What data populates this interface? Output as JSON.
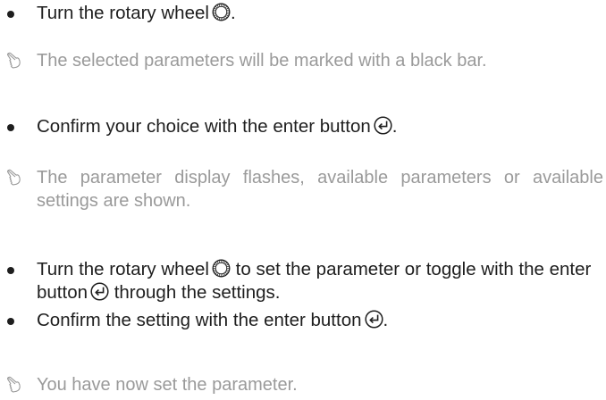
{
  "instructions": [
    {
      "kind": "step",
      "text_before": "Turn the rotary wheel",
      "icon": "rotary-wheel-icon",
      "text_after": "."
    },
    {
      "kind": "result",
      "text": "The selected parameters will be marked with a black bar."
    },
    {
      "kind": "step",
      "text_before": "Confirm your choice with the enter button",
      "icon": "enter-button-icon",
      "text_after": "."
    },
    {
      "kind": "result",
      "text": "The parameter display flashes, available parameters or available settings are shown."
    },
    {
      "kind": "step",
      "text_1": "Turn the rotary wheel",
      "icon_1": "rotary-wheel-icon",
      "text_2": "to set the parameter or toggle with the enter button",
      "icon_2": "enter-button-icon",
      "text_3": "through the settings."
    },
    {
      "kind": "step",
      "text_before": "Confirm the setting with the enter button",
      "icon": "enter-button-icon",
      "text_after": "."
    },
    {
      "kind": "result",
      "text": "You have now set the parameter."
    }
  ],
  "icons": {
    "step_marker": "bullet",
    "result_marker": "pointing-hand-icon"
  },
  "colors": {
    "step_text": "#1e1e1e",
    "result_text": "#9a9a9a"
  }
}
